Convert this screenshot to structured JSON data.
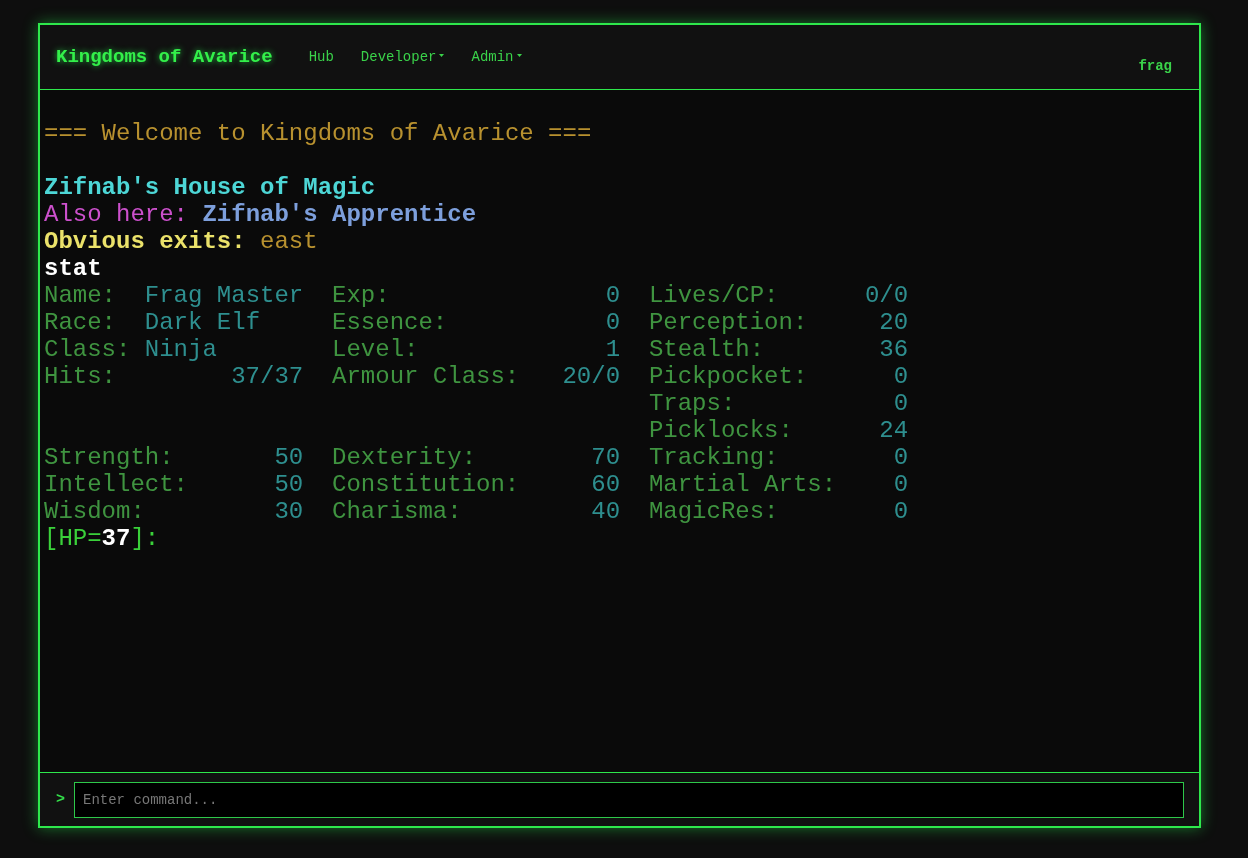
{
  "header": {
    "title": "Kingdoms of Avarice",
    "nav": [
      {
        "label": "Hub",
        "dropdown": false
      },
      {
        "label": "Developer",
        "dropdown": true
      },
      {
        "label": "Admin",
        "dropdown": true
      }
    ],
    "user": "frag"
  },
  "output": {
    "banner": "=== Welcome to Kingdoms of Avarice ===",
    "room": {
      "name": "Zifnab's House of Magic",
      "also_here_label": "Also here:",
      "also_here": "Zifnab's Apprentice",
      "exits_label": "Obvious exits:",
      "exits": "east"
    },
    "command": "stat",
    "stats": [
      {
        "cells": [
          {
            "kind": "text",
            "label": "Name:",
            "value": "Frag Master"
          },
          {
            "kind": "number",
            "label": "Exp:",
            "value": "0"
          },
          {
            "kind": "number",
            "label": "Lives/CP:",
            "value": "0/0"
          }
        ]
      },
      {
        "cells": [
          {
            "kind": "text",
            "label": "Race:",
            "value": "Dark Elf"
          },
          {
            "kind": "number",
            "label": "Essence:",
            "value": "0"
          },
          {
            "kind": "number",
            "label": "Perception:",
            "value": "20"
          }
        ]
      },
      {
        "cells": [
          {
            "kind": "text",
            "label": "Class:",
            "value": "Ninja"
          },
          {
            "kind": "number",
            "label": "Level:",
            "value": "1"
          },
          {
            "kind": "number",
            "label": "Stealth:",
            "value": "36"
          }
        ]
      },
      {
        "cells": [
          {
            "kind": "number",
            "label": "Hits:",
            "value": "37/37"
          },
          {
            "kind": "number",
            "label": "Armour Class:",
            "value": "20/0"
          },
          {
            "kind": "number",
            "label": "Pickpocket:",
            "value": "0"
          }
        ]
      },
      {
        "cells": [
          {
            "kind": "blank"
          },
          {
            "kind": "blank"
          },
          {
            "kind": "number",
            "label": "Traps:",
            "value": "0"
          }
        ]
      },
      {
        "cells": [
          {
            "kind": "blank"
          },
          {
            "kind": "blank"
          },
          {
            "kind": "number",
            "label": "Picklocks:",
            "value": "24"
          }
        ]
      },
      {
        "cells": [
          {
            "kind": "number",
            "label": "Strength:",
            "value": "50"
          },
          {
            "kind": "number",
            "label": "Dexterity:",
            "value": "70"
          },
          {
            "kind": "number",
            "label": "Tracking:",
            "value": "0"
          }
        ]
      },
      {
        "cells": [
          {
            "kind": "number",
            "label": "Intellect:",
            "value": "50"
          },
          {
            "kind": "number",
            "label": "Constitution:",
            "value": "60"
          },
          {
            "kind": "number",
            "label": "Martial Arts:",
            "value": "0"
          }
        ]
      },
      {
        "cells": [
          {
            "kind": "number",
            "label": "Wisdom:",
            "value": "30"
          },
          {
            "kind": "number",
            "label": "Charisma:",
            "value": "40"
          },
          {
            "kind": "number",
            "label": "MagicRes:",
            "value": "0"
          }
        ]
      }
    ],
    "prompt": "[HP=**37**]:"
  },
  "command_bar": {
    "symbol": ">",
    "placeholder": "Enter command..."
  }
}
